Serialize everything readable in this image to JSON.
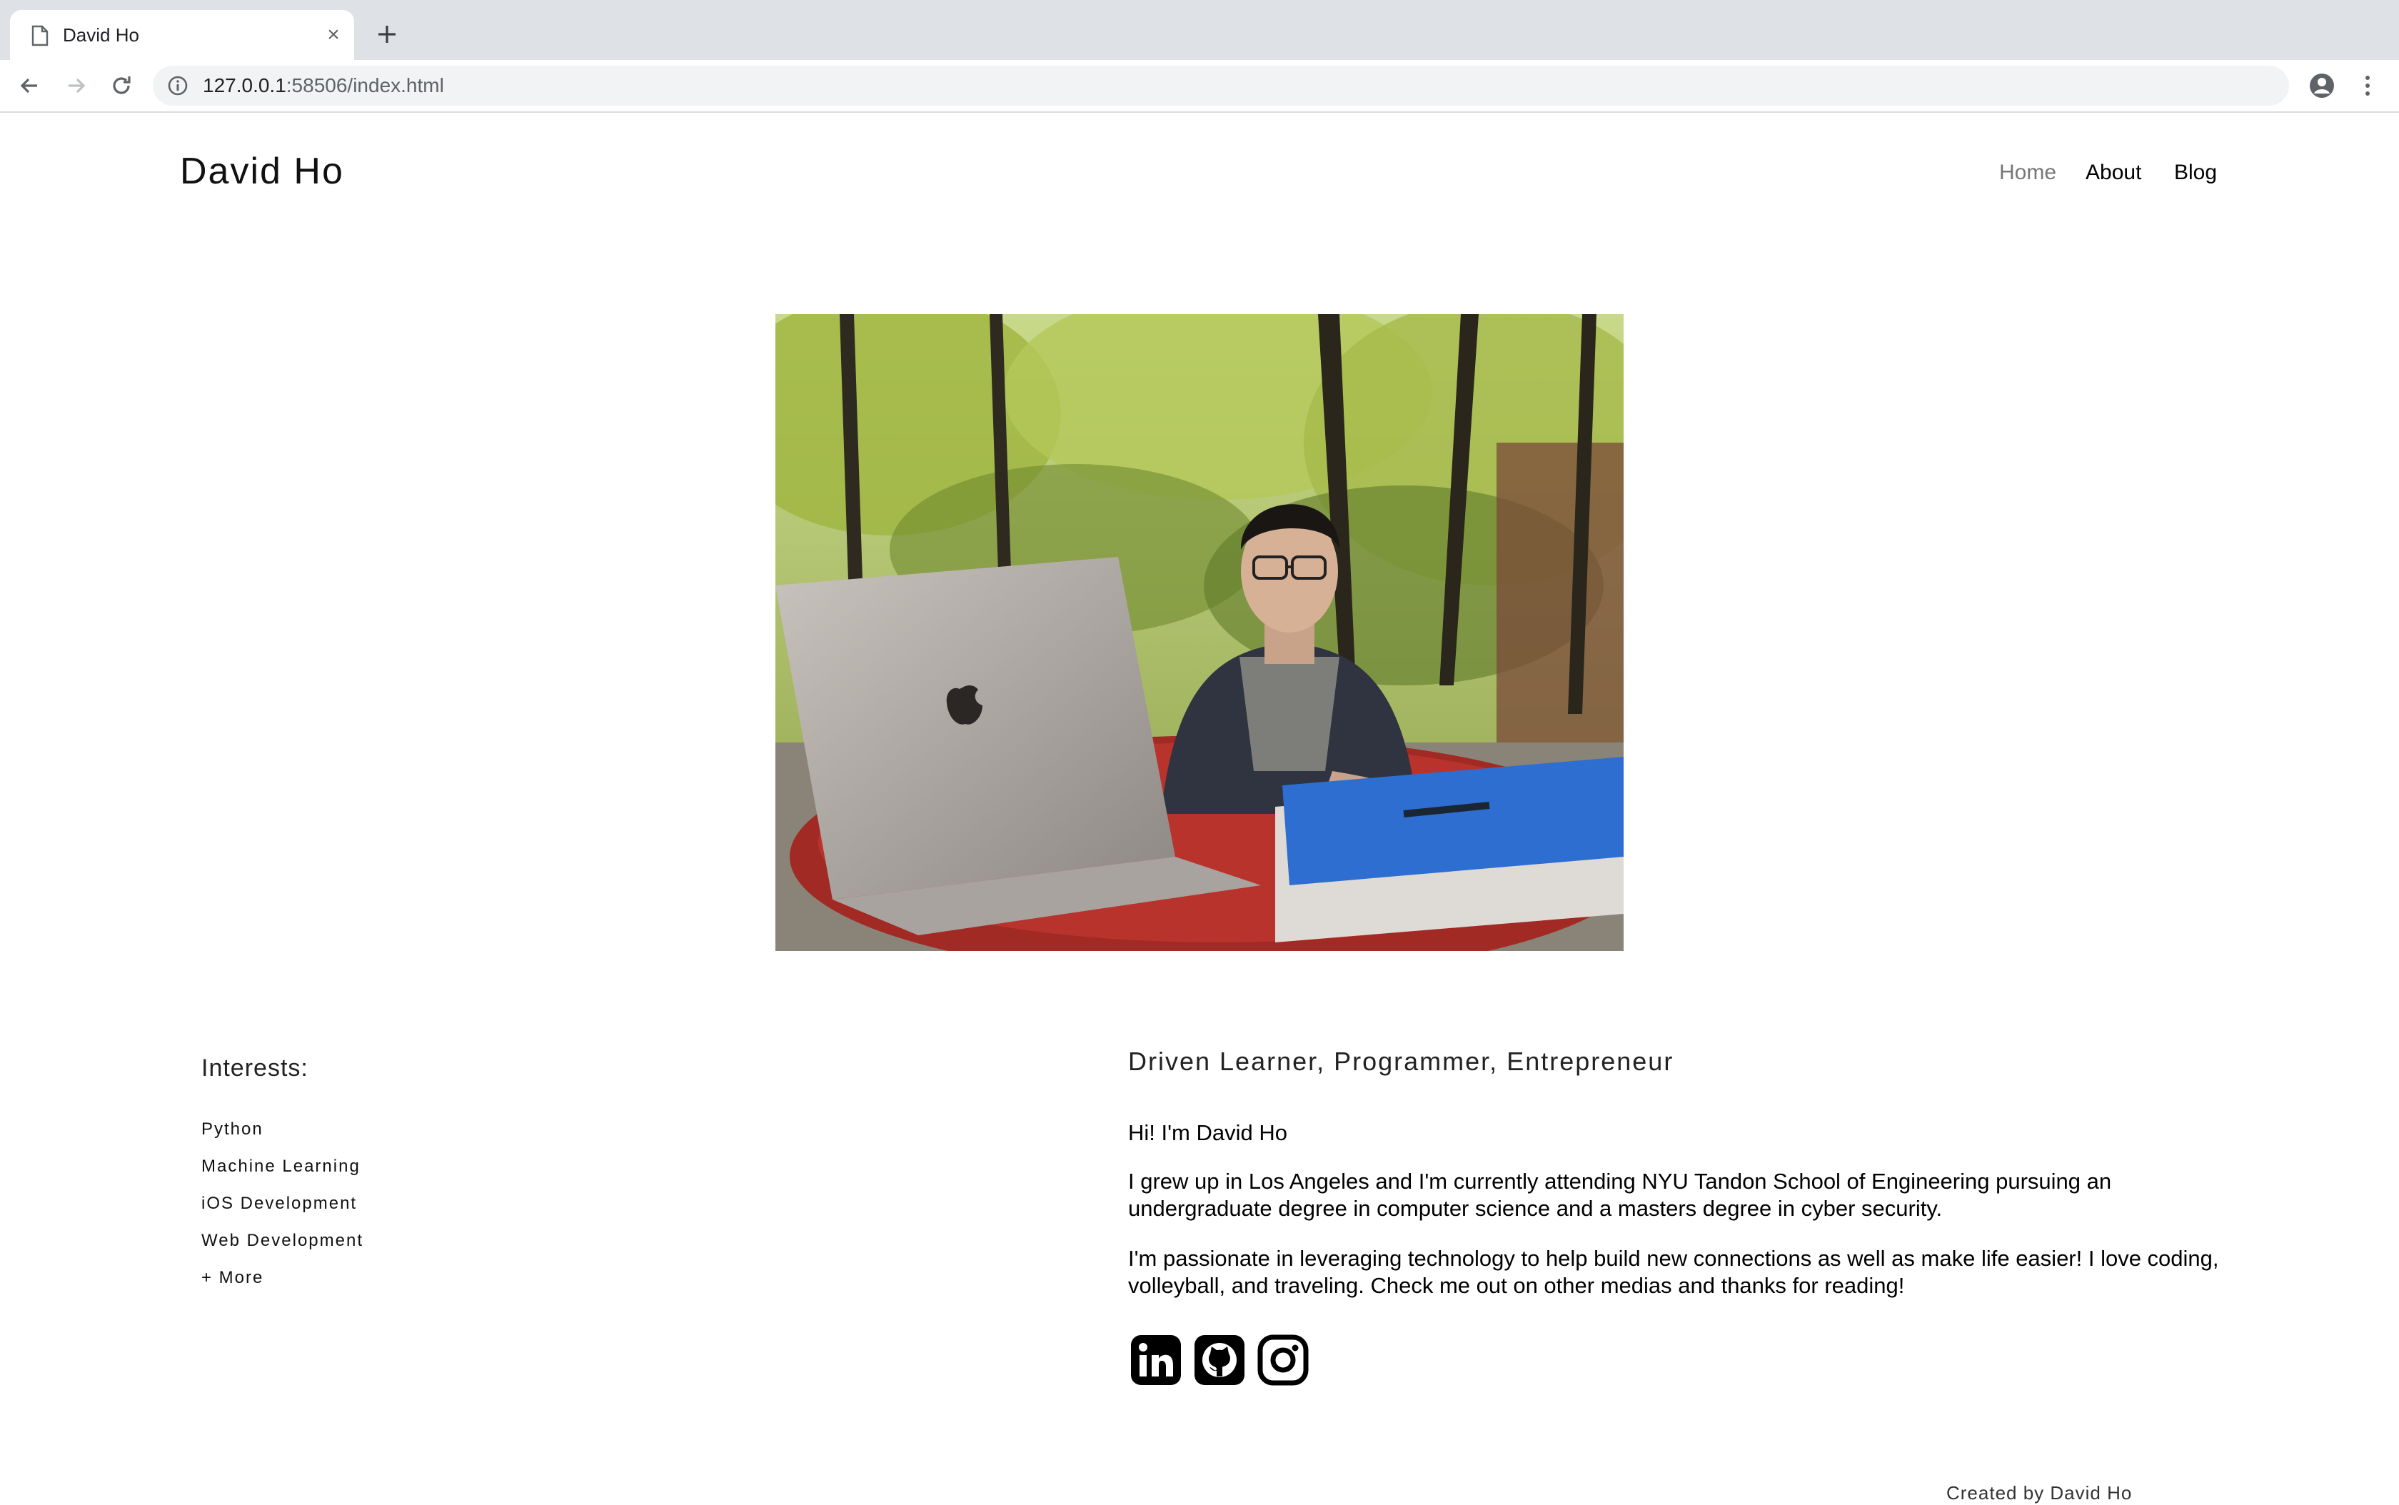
{
  "browser": {
    "tab_title": "David Ho",
    "url_host": "127.0.0.1",
    "url_path": ":58506/index.html"
  },
  "site": {
    "title": "David Ho",
    "nav": [
      "Home",
      "About",
      "Blog"
    ]
  },
  "interests": {
    "heading": "Interests:",
    "items": [
      "Python",
      "Machine Learning",
      "iOS Development",
      "Web Development",
      "+ More"
    ]
  },
  "about": {
    "tagline": "Driven Learner, Programmer, Entrepreneur",
    "greeting": "Hi! I'm David Ho",
    "p1": "I grew up in Los Angeles and I'm currently attending NYU Tandon School of Engineering pursuing an undergraduate degree in computer science and a masters degree in cyber security.",
    "p2": "I'm passionate in leveraging technology to help build new connections as well as make life easier! I love coding, volleyball, and traveling. Check me out on other medias and thanks for reading!"
  },
  "social_icons": [
    "linkedin-icon",
    "github-icon",
    "instagram-icon"
  ],
  "footer": {
    "text": "Created by David Ho"
  },
  "colors": {
    "nav_active": "#777777",
    "chrome_bg": "#dee1e6"
  }
}
